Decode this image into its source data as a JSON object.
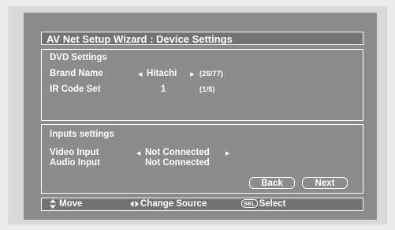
{
  "window": {
    "title": "AV Net Setup Wizard : Device Settings"
  },
  "dvd_settings": {
    "heading": "DVD Settings",
    "brand_label": "Brand Name",
    "brand_value": "Hitachi",
    "brand_count": "(26/77)",
    "ir_label": "IR Code Set",
    "ir_value": "1",
    "ir_count": "(1/5)"
  },
  "inputs_settings": {
    "heading": "Inputs settings",
    "video_label": "Video Input",
    "video_value": "Not Connected",
    "audio_label": "Audio Input",
    "audio_value": "Not Connected"
  },
  "buttons": {
    "back": "Back",
    "next": "Next"
  },
  "footer": {
    "move": "Move",
    "change_source": "Change Source",
    "sel_badge": "SEL",
    "select": "Select"
  },
  "icons": {
    "left": "arrow-left-icon",
    "right": "arrow-right-icon",
    "updown": "up-down-icon",
    "leftright": "left-right-icon"
  },
  "colors": {
    "screen": "#8c8c8c",
    "title_bar": "#737373",
    "text": "#ffffff",
    "frame": "#d9d9d9"
  }
}
